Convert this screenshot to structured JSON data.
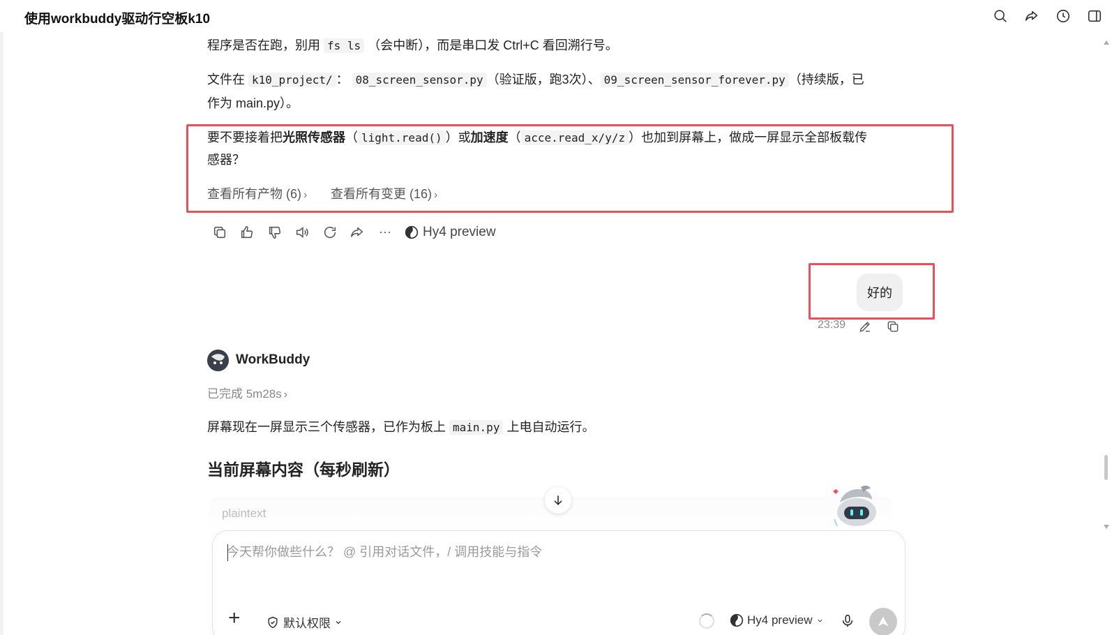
{
  "window": {
    "title": "使用workbuddy驱动行空板k10",
    "icons": [
      "search-icon",
      "share-icon",
      "history-icon",
      "sidebar-toggle-icon"
    ]
  },
  "message": {
    "line1_text": "程序是否在跑，别用",
    "line1_code": "fs ls",
    "line1_rest": "（会中断），而是串口发 Ctrl+C 看回溯行号。",
    "line2_prefix": "文件在",
    "line2_code1": "k10_project/",
    "line2_sep": "：",
    "line2_code2": "08_screen_sensor.py",
    "line2_mid": "（验证版，跑3次）、",
    "line2_code3": "09_screen_sensor_forever.py",
    "line2_suffix": "（持续版，已",
    "line3": "作为 main.py）。",
    "q_prefix": "要不要接着把",
    "q_bold1": "光照传感器",
    "q_paren_open": "（",
    "q_code1": "light.read()",
    "q_paren_close": "）或",
    "q_bold2": "加速度",
    "q_paren_open2": "（",
    "q_code2": "acce.read_x/y/z",
    "q_rest": "）也加到屏幕上，做成一屏显示全部板载传",
    "q_line2": "感器？",
    "link_artifacts": "查看所有产物 (6)",
    "link_changes": "查看所有变更 (16)",
    "model_tag": "Hy4 preview"
  },
  "user_message": {
    "text": "好的",
    "time": "23:39"
  },
  "bot": {
    "name": "WorkBuddy",
    "status": "已完成 5m28s",
    "reply_prefix": "屏幕现在一屏显示三个传感器，已作为板上",
    "reply_code": "main.py",
    "reply_suffix": "上电自动运行。",
    "heading": "当前屏幕内容（每秒刷新）",
    "code_lang": "plaintext"
  },
  "composer": {
    "placeholder": "今天帮你做些什么？ @ 引用对话文件，/ 调用技能与指令",
    "permission_label": "默认权限",
    "model_label": "Hy4 preview"
  }
}
